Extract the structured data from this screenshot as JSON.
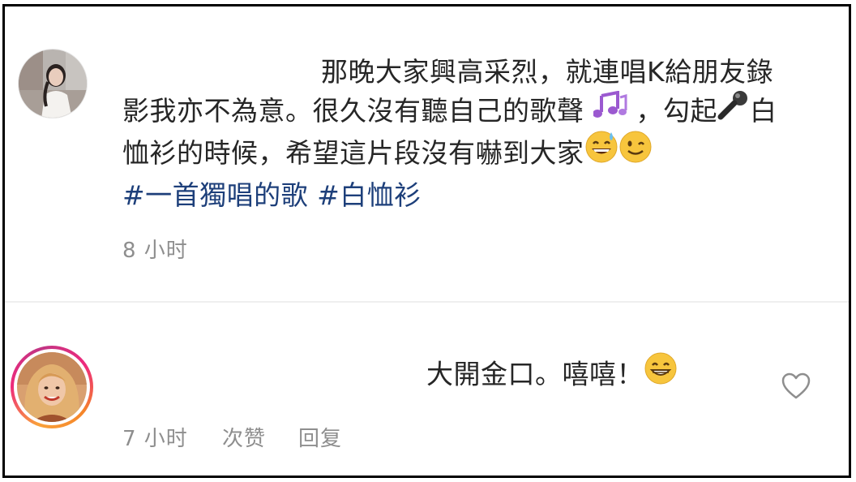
{
  "caption": {
    "line1": "那晚大家興高采烈，就連唱K給朋友錄",
    "line2_a": "影我亦不為意。很久沒有聽自己的歌聲",
    "line2_b": "，勾起",
    "line2_c": "白",
    "line3": "恤衫的時候，希望這片段沒有嚇到大家",
    "hashtags": [
      "#一首獨唱的歌",
      "#白恤衫"
    ],
    "time": "8 小时"
  },
  "reply": {
    "text": "大開金口。嘻嘻！",
    "time": "7 小时",
    "like_label": "次赞",
    "reply_label": "回复"
  },
  "icons": {
    "music_notes": "music-notes-emoji",
    "microphone": "microphone-emoji",
    "sweat_smile": "sweat-smile-emoji",
    "wink": "wink-emoji",
    "grin": "grin-emoji",
    "heart": "heart-outline-icon"
  },
  "colors": {
    "text": "#262626",
    "hashtag": "#1d3f7a",
    "meta": "#8e8e8e",
    "ring_orange": "#f9a13a",
    "ring_pink": "#ee2a7b"
  }
}
